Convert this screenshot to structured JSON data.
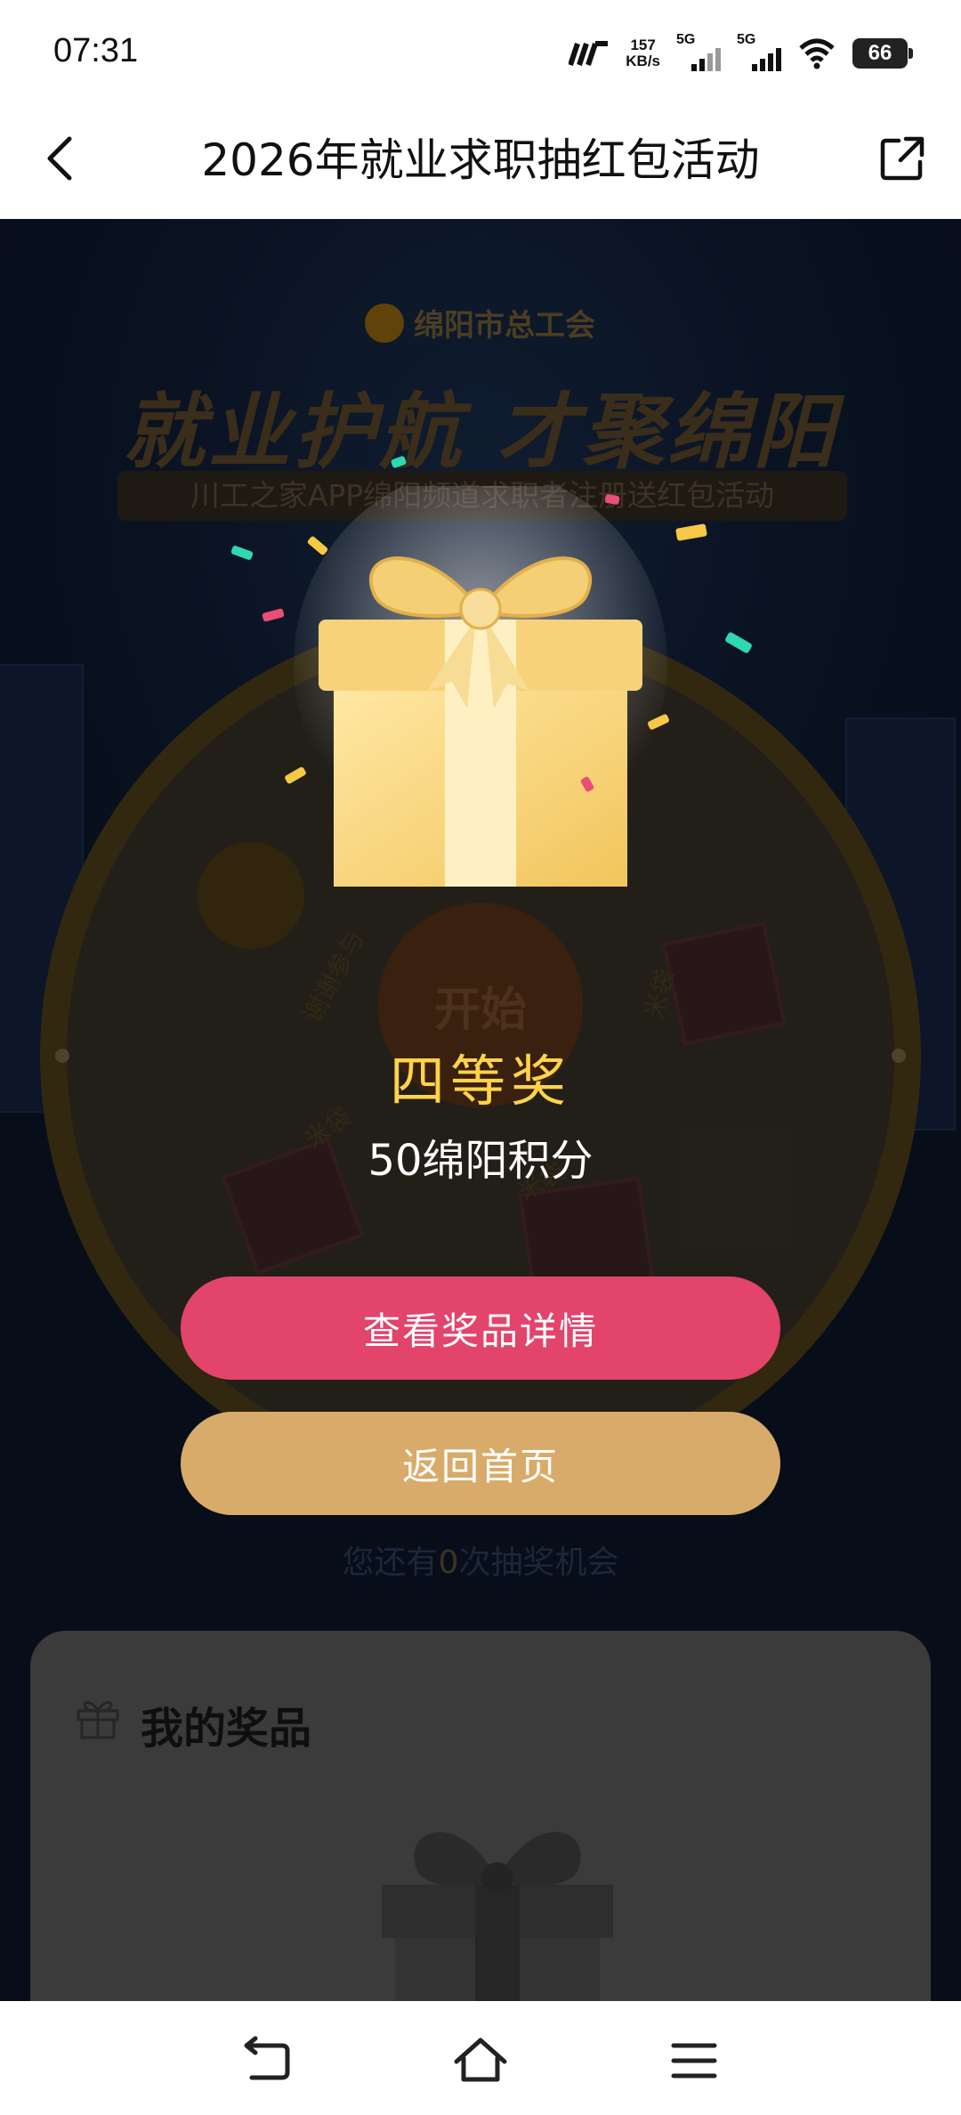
{
  "status_bar": {
    "time": "07:31",
    "network_speed_value": "157",
    "network_speed_unit": "KB/s",
    "sim1_label": "5G",
    "sim2_label": "5G",
    "battery_level": "66"
  },
  "nav": {
    "title": "2026年就业求职抽红包活动"
  },
  "banner": {
    "org_name": "绵阳市总工会",
    "headline": "就业护航 才聚绵阳",
    "subtitle": "川工之家APP绵阳频道求职者注册送红包活动"
  },
  "wheel": {
    "start_label": "开始",
    "segment_thanks": "谢谢参与",
    "segment_prize_a": "米袋",
    "segment_prize_b": "米袋",
    "segment_prize_c": "米袋"
  },
  "result_modal": {
    "prize_level": "四等奖",
    "prize_name": "50绵阳积分",
    "detail_button": "查看奖品详情",
    "home_button": "返回首页"
  },
  "chances": {
    "prefix": "您还有",
    "count": "0",
    "suffix": "次抽奖机会"
  },
  "my_prizes": {
    "title": "我的奖品"
  },
  "colors": {
    "accent_pink": "#e2446b",
    "accent_gold": "#d9ab6a",
    "prize_yellow": "#ffd34a",
    "background_navy": "#0e1a31"
  },
  "icons": [
    "back-arrow-icon",
    "share-icon",
    "gift-icon",
    "system-back-icon",
    "system-home-icon",
    "system-menu-icon"
  ]
}
